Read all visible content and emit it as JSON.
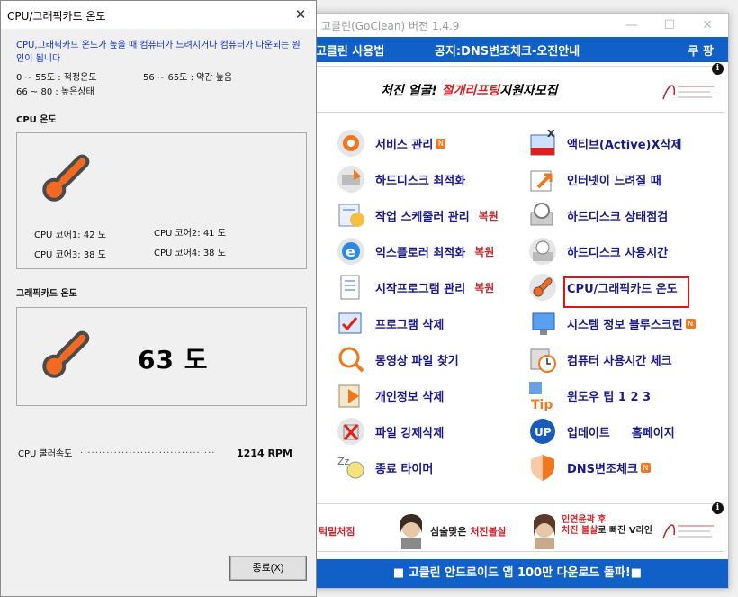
{
  "main_window": {
    "title": "고클린(GoClean) 버전 1.4.9",
    "menu": {
      "usage": "고클린 사용법",
      "notice": "공지:DNS변조체크-오진안내",
      "coupon": "쿠 팡"
    },
    "banner_top": {
      "part1": "처진 얼굴! ",
      "part2": "절개리프팅",
      "part3": "지원자모집"
    },
    "left_items": [
      {
        "label": "서비스 관리",
        "badge": "N",
        "restore": ""
      },
      {
        "label": "하드디스크 최적화",
        "badge": "",
        "restore": ""
      },
      {
        "label": "작업 스케줄러 관리",
        "badge": "",
        "restore": "복원"
      },
      {
        "label": "익스플로러 최적화",
        "badge": "",
        "restore": "복원"
      },
      {
        "label": "시작프로그램 관리",
        "badge": "",
        "restore": "복원"
      },
      {
        "label": "프로그램 삭제",
        "badge": "",
        "restore": ""
      },
      {
        "label": "동영상 파일 찾기",
        "badge": "",
        "restore": ""
      },
      {
        "label": "개인정보 삭제",
        "badge": "",
        "restore": ""
      },
      {
        "label": "파일 강제삭제",
        "badge": "",
        "restore": ""
      },
      {
        "label": "종료 타이머",
        "badge": "",
        "restore": ""
      }
    ],
    "right_items": [
      {
        "label": "액티브(Active)X삭제",
        "badge": ""
      },
      {
        "label": "인터넷이 느려질 때",
        "badge": ""
      },
      {
        "label": "하드디스크 상태점검",
        "badge": ""
      },
      {
        "label": "하드디스크 사용시간",
        "badge": ""
      },
      {
        "label": "CPU/그래픽카드 온도",
        "badge": ""
      },
      {
        "label": "시스템 정보 블루스크린",
        "badge": "N"
      },
      {
        "label": "컴퓨터 사용시간 체크",
        "badge": ""
      },
      {
        "label": "윈도우 팁  1    2    3",
        "badge": ""
      },
      {
        "label": "업데이트",
        "badge": "",
        "extra": "홈페이지"
      },
      {
        "label": "DNS변조체크",
        "badge": "N"
      }
    ],
    "banner_bottom": {
      "a": "턱밑처짐",
      "b1": "심술맞은 ",
      "b2": "처진볼살",
      "c1": "인연윤곽 후",
      "c2": "처진 볼살",
      "c3": "로 빠진 V라인"
    },
    "footer": "■ 고클린 안드로이드 앱 100만 다운로드 돌파!■"
  },
  "temp_window": {
    "title": "CPU/그래픽카드 온도",
    "warning": "CPU,그래픽카드 온도가 높을 때 컴퓨터가 느려지거나 컴퓨터가 다운되는 원인이 됩니다",
    "range_normal": "0  ~ 55도 : 적정온도",
    "range_slight": "56 ~ 65도 : 약간 높음",
    "range_high": "66 ~ 80 : 높은상태",
    "cpu_label": "CPU 온도",
    "cores": [
      "CPU 코어1: 42 도",
      "CPU 코어2: 41 도",
      "CPU 코어3: 38 도",
      "CPU 코어4: 38 도"
    ],
    "gpu_label": "그래픽카드 온도",
    "gpu_temp": "63 도",
    "fan_label": "CPU 쿨러속도",
    "fan_value": "1214 RPM",
    "close_label": "종료(X)"
  },
  "colors": {
    "accent_blue": "#1060c8",
    "highlight_red": "#e0141e",
    "link_text": "#1a1a8a"
  },
  "icons": [
    "gear-icon",
    "defrag-icon",
    "scheduler-icon",
    "ie-icon",
    "startup-icon",
    "uninstall-icon",
    "magnifier-icon",
    "privacy-icon",
    "force-delete-icon",
    "timer-icon",
    "activex-icon",
    "network-icon",
    "disk-check-icon",
    "disk-time-icon",
    "thermometer-icon",
    "sysinfo-icon",
    "clock-icon",
    "tip-icon",
    "update-icon",
    "shield-icon"
  ]
}
